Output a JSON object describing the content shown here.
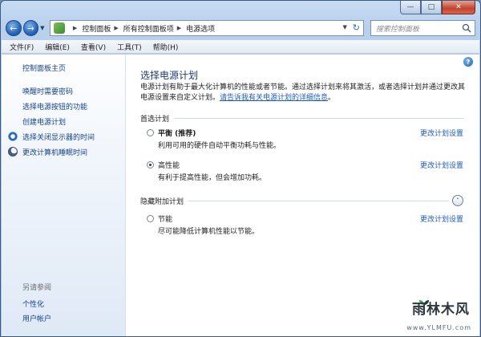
{
  "navbar": {
    "breadcrumb": [
      "控制面板",
      "所有控制面板项",
      "电源选项"
    ],
    "search_placeholder": "搜索控制面板"
  },
  "menubar": [
    "文件(F)",
    "编辑(E)",
    "查看(V)",
    "工具(T)",
    "帮助(H)"
  ],
  "sidebar": {
    "home": "控制面板主页",
    "items": [
      "唤醒时需要密码",
      "选择电源按钮的功能",
      "创建电源计划",
      "选择关闭显示器的时间",
      "更改计算机睡眠时间"
    ],
    "see_also_title": "另请参阅",
    "see_also": [
      "个性化",
      "用户帐户"
    ]
  },
  "main": {
    "title": "选择电源计划",
    "desc_text": "电源计划有助于最大化计算机的性能或者节能。通过选择计划来将其激活，或者选择计划并通过更改其电源设置来自定义计划。",
    "desc_link": "请告诉我有关电源计划的详细信息",
    "desc_end": "。",
    "preferred_title": "首选计划",
    "hidden_title": "隐藏附加计划",
    "plans": [
      {
        "name": "平衡 (推荐)",
        "desc": "利用可用的硬件自动平衡功耗与性能。",
        "change": "更改计划设置",
        "selected": false
      },
      {
        "name": "高性能",
        "desc": "有利于提高性能，但会增加功耗。",
        "change": "更改计划设置",
        "selected": true
      },
      {
        "name": "节能",
        "desc": "尽可能降低计算机性能以节能。",
        "change": "更改计划设置",
        "selected": false
      }
    ]
  },
  "watermark": {
    "brand": "雨林木风",
    "url": "www.YLMFU.com"
  }
}
